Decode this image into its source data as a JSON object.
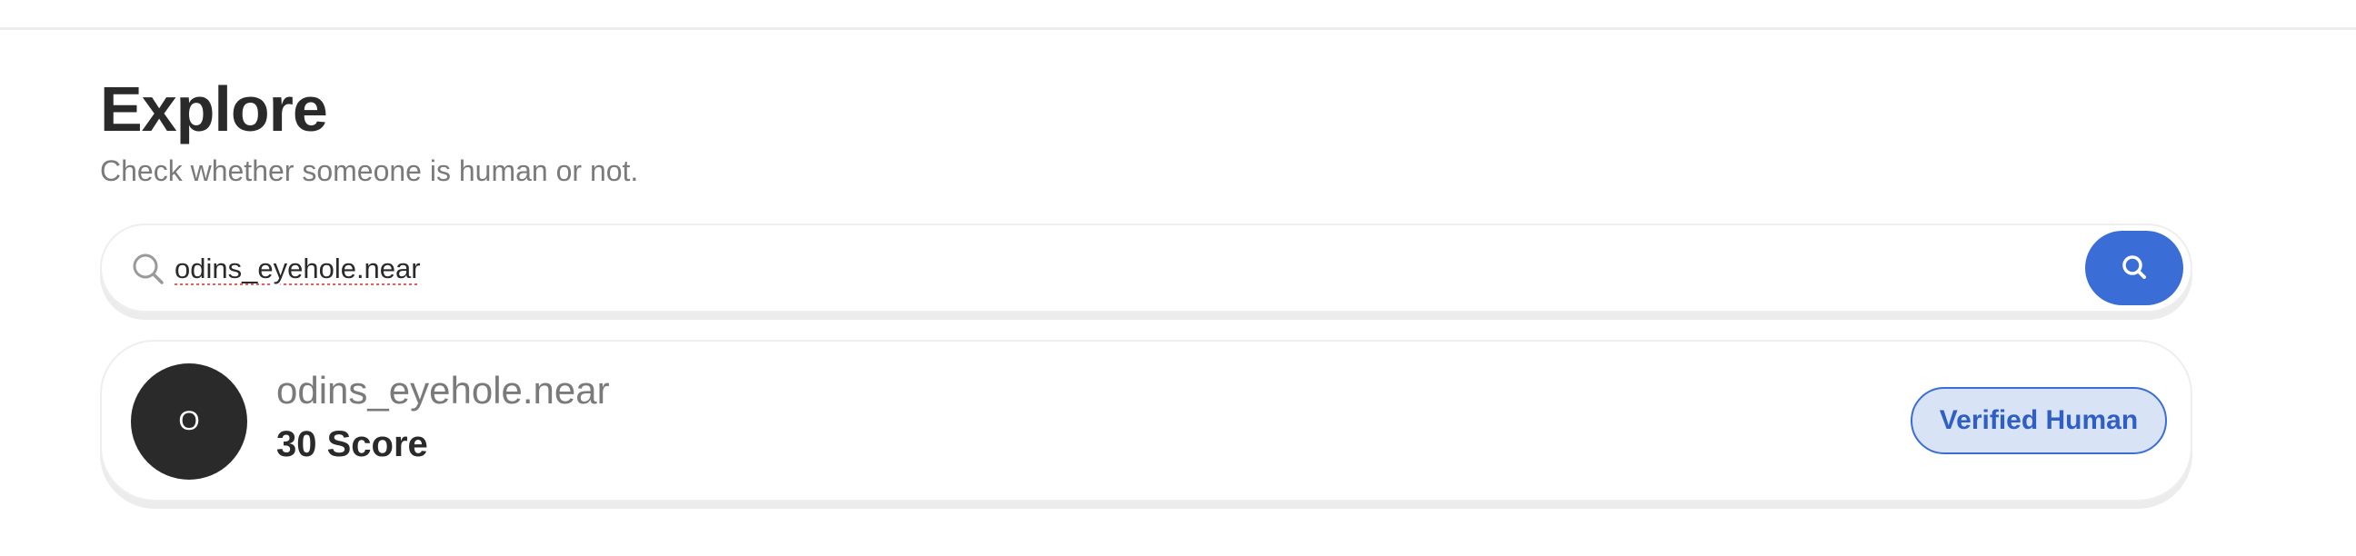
{
  "header": {
    "title": "Explore",
    "subtitle": "Check whether someone is human or not."
  },
  "search": {
    "value": "odins_eyehole.near",
    "leading_icon": "search-icon",
    "button_icon": "search-icon",
    "accent_color": "#3a6ed6"
  },
  "result": {
    "avatar_initial": "O",
    "name": "odins_eyehole.near",
    "score": "30 Score",
    "badge": "Verified Human",
    "badge_color": "#3a6ed6",
    "badge_bg": "#d8e3f6"
  }
}
